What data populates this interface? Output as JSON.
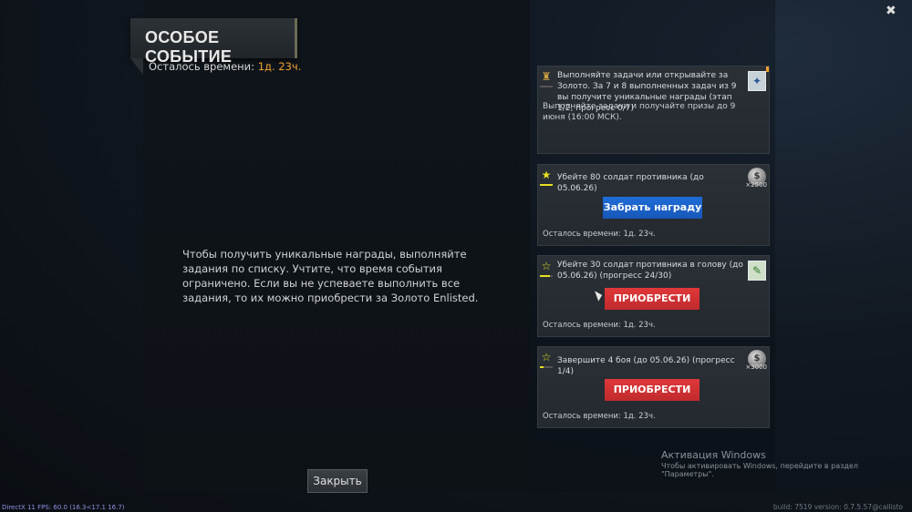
{
  "event": {
    "title": "ОСОБОЕ СОБЫТИЕ",
    "time_label": "Осталось времени:",
    "time_value": "1д. 23ч.",
    "description": "Чтобы получить уникальные награды, выполняйте задания по списку. Учтите, что время события ограничено. Если вы не успеваете выполнить все задания, то их можно приобрести за Золото Enlisted.",
    "close_label": "Закрыть"
  },
  "header_card": {
    "text": "Выполняйте задачи или открывайте за Золото. За 7 и 8 выполненных задач из 9 вы получите уникальные награды (этап 1/2, прогресс 0/7)",
    "sub_text": "Выполняйте задачи и получайте призы до 9 июня (16:00 МСК).",
    "icon": "medal-icon",
    "reward_icon": "weapon-icon"
  },
  "tasks": [
    {
      "text": "Убейте 80 солдат противника (до 05.06.26)",
      "button_label": "Забрать награду",
      "button_color": "#1e6cd8",
      "reward_amount": "×2500",
      "time_text": "Осталось времени:  1д. 23ч.",
      "icon": "star-filled-icon",
      "progress": 1.0
    },
    {
      "text": "Убейте 30 солдат противника в голову (до 05.06.26) (прогресс 24/30)",
      "button_label": "ПРИОБРЕСТИ",
      "button_color": "#e0383a",
      "reward_amount": "",
      "time_text": "Осталось времени:  1д. 23ч.",
      "icon": "star-outline-icon",
      "progress": 0.8
    },
    {
      "text": "Завершите 4 боя (до 05.06.26) (прогресс 1/4)",
      "button_label": "ПРИОБРЕСТИ",
      "button_color": "#e0383a",
      "reward_amount": "×3000",
      "time_text": "Осталось времени:  1д. 23ч.",
      "icon": "star-outline-icon",
      "progress": 0.25
    }
  ],
  "overlay": {
    "activation_title": "Активация Windows",
    "activation_sub": "Чтобы активировать Windows, перейдите в раздел \"Параметры\".",
    "fps": "DirectX 11 FPS: 60.0 (16.3<17.1 16.7)",
    "build": "build: 7519 version: 0.7.5.57@callisto"
  },
  "colors": {
    "accent_gold": "#f0a030",
    "button_blue": "#1e6cd8",
    "button_red": "#e0383a",
    "star_yellow": "#e8e020"
  }
}
